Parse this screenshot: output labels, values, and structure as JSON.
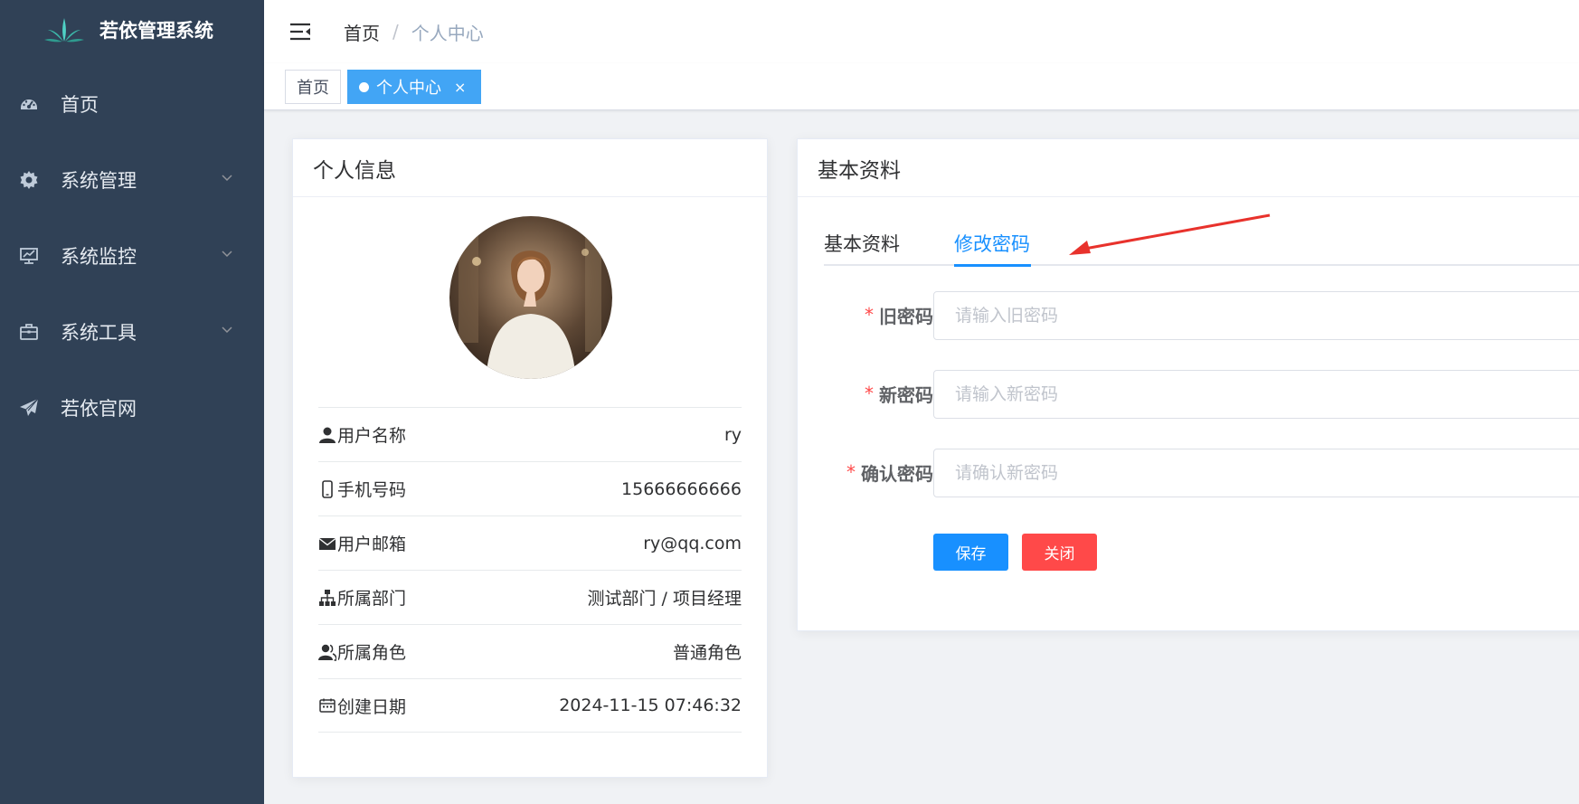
{
  "app": {
    "title": "若依管理系统"
  },
  "sidebar": {
    "items": [
      {
        "label": "首页",
        "icon": "dashboard-icon",
        "has_children": false
      },
      {
        "label": "系统管理",
        "icon": "gear-icon",
        "has_children": true
      },
      {
        "label": "系统监控",
        "icon": "monitor-icon",
        "has_children": true
      },
      {
        "label": "系统工具",
        "icon": "toolbox-icon",
        "has_children": true
      },
      {
        "label": "若依官网",
        "icon": "paper-plane-icon",
        "has_children": false
      }
    ]
  },
  "navbar": {
    "breadcrumb": {
      "home": "首页",
      "separator": "/",
      "current": "个人中心"
    }
  },
  "tags": {
    "home": "首页",
    "active": "个人中心",
    "close": "×"
  },
  "profile": {
    "header": "个人信息",
    "rows": [
      {
        "label": "用户名称",
        "value": "ry",
        "icon": "user-icon"
      },
      {
        "label": "手机号码",
        "value": "15666666666",
        "icon": "phone-icon"
      },
      {
        "label": "用户邮箱",
        "value": "ry@qq.com",
        "icon": "mail-icon"
      },
      {
        "label": "所属部门",
        "value": "测试部门 / 项目经理",
        "icon": "tree-icon"
      },
      {
        "label": "所属角色",
        "value": "普通角色",
        "icon": "peoples-icon"
      },
      {
        "label": "创建日期",
        "value": "2024-11-15 07:46:32",
        "icon": "date-icon"
      }
    ]
  },
  "basic": {
    "header": "基本资料",
    "tabs": [
      {
        "label": "基本资料",
        "active": false
      },
      {
        "label": "修改密码",
        "active": true
      }
    ],
    "fields": {
      "old": {
        "label": "旧密码",
        "placeholder": "请输入旧密码"
      },
      "new": {
        "label": "新密码",
        "placeholder": "请输入新密码"
      },
      "confirm": {
        "label": "确认密码",
        "placeholder": "请确认新密码"
      }
    },
    "required_mark": "*",
    "save": "保存",
    "close": "关闭"
  },
  "colors": {
    "sidebar_bg": "#304156",
    "primary": "#1890ff",
    "tag_active": "#42a5f5",
    "danger": "#ff4949",
    "annotation_arrow": "#e8322c"
  }
}
